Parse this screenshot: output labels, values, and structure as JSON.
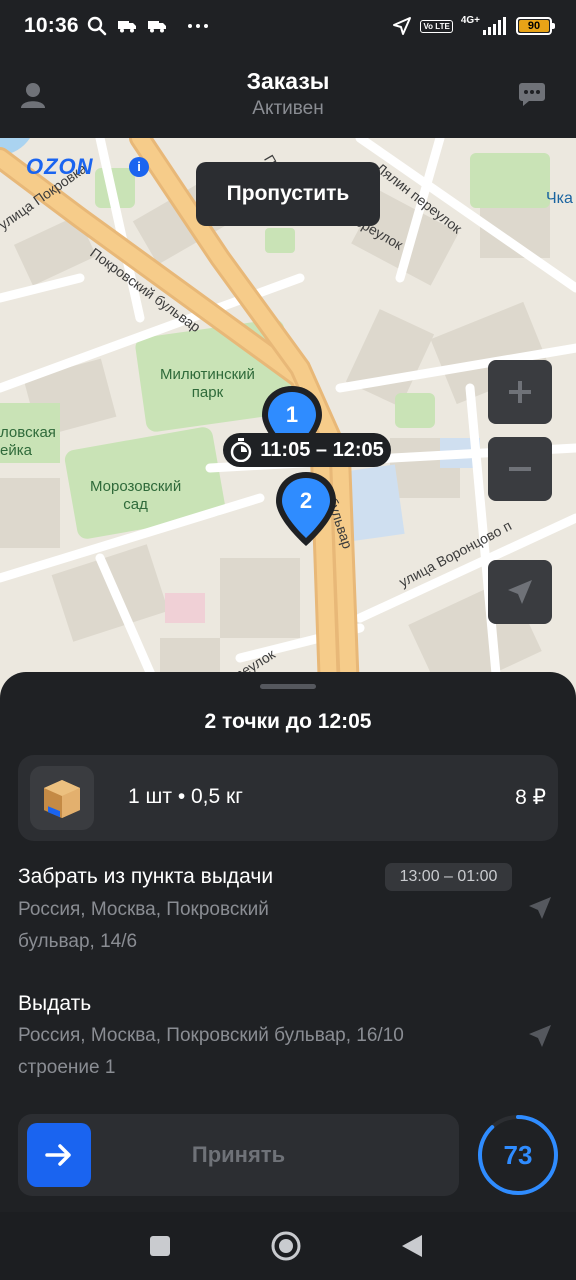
{
  "status_bar": {
    "time": "10:36",
    "network": "4G+",
    "volte": "Vo LTE",
    "battery": "90"
  },
  "header": {
    "title": "Заказы",
    "subtitle": "Активен"
  },
  "map": {
    "logo": "OZON",
    "info_icon": "i",
    "skip_label": "Пропустить",
    "pins": [
      {
        "number": "1"
      },
      {
        "number": "2"
      }
    ],
    "time_window": "11:05 – 12:05",
    "street_labels": {
      "pokrovka": "улица Покровка",
      "pokrovsky_blvd": "Покровский бульвар",
      "lyalin": "Лялин переулок",
      "pereulok_top": "переулок",
      "vorontsovo": "улица Воронцово п",
      "bulvar": "бульвар",
      "pereulok_bottom": "реулок",
      "chka": "Чка",
      "p_top": "П"
    },
    "parks": {
      "militinsky": "Милютинский\nпарк",
      "morozovsky": "Морозовский\nсад",
      "left": "ловская\nейка"
    }
  },
  "sheet": {
    "title": "2 точки до 12:05",
    "cargo": {
      "quantity_weight": "1 шт • 0,5 кг",
      "price": "8 ₽",
      "box_label": "OZON"
    },
    "pickup": {
      "title": "Забрать из пункта выдачи",
      "time": "13:00 – 01:00",
      "address": "Россия, Москва, Покровский бульвар, 14/6"
    },
    "delivery": {
      "title": "Выдать",
      "address": "Россия, Москва, Покровский бульвар, 16/10 строение 1"
    },
    "accept_label": "Принять",
    "timer_value": "73",
    "timer_progress": 0.88
  },
  "colors": {
    "accent": "#1a64f0",
    "timer": "#2f8cff",
    "battery": "#e8a317",
    "background": "#1f2124"
  }
}
